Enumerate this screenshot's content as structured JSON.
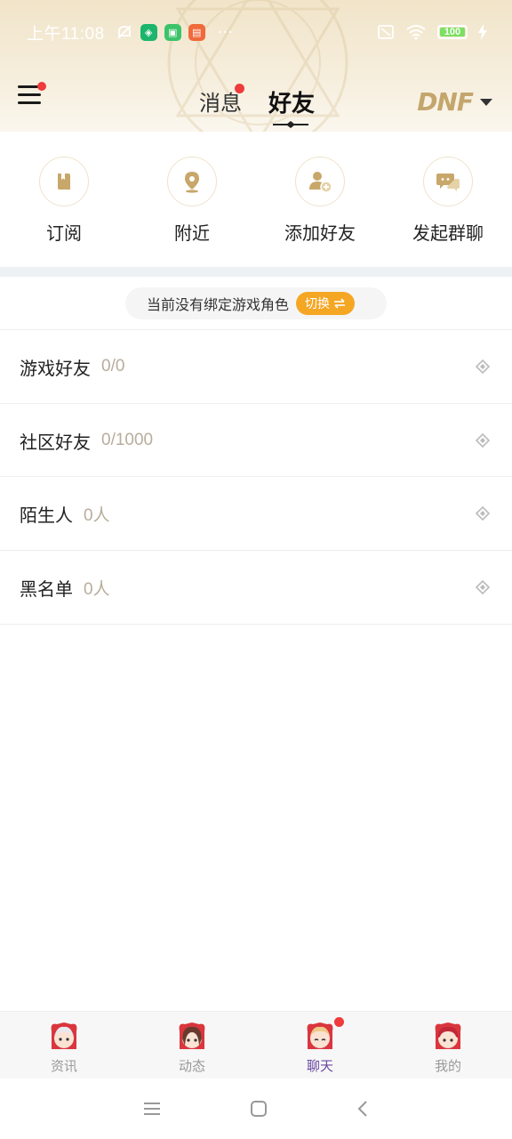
{
  "status_bar": {
    "time": "上午11:08",
    "more": "···",
    "battery_level": "100"
  },
  "header": {
    "tabs": [
      {
        "label": "消息",
        "active": false,
        "has_badge": true
      },
      {
        "label": "好友",
        "active": true,
        "has_badge": false
      }
    ],
    "game_logo": "DNF",
    "menu_has_badge": true
  },
  "quick_actions": [
    {
      "label": "订阅",
      "icon": "bookmark-icon"
    },
    {
      "label": "附近",
      "icon": "location-pin-icon"
    },
    {
      "label": "添加好友",
      "icon": "add-user-icon"
    },
    {
      "label": "发起群聊",
      "icon": "group-chat-icon"
    }
  ],
  "notice": {
    "text": "当前没有绑定游戏角色",
    "switch_label": "切换"
  },
  "friend_groups": [
    {
      "title": "游戏好友",
      "count": "0/0"
    },
    {
      "title": "社区好友",
      "count": "0/1000"
    },
    {
      "title": "陌生人",
      "count": "0人"
    },
    {
      "title": "黑名单",
      "count": "0人"
    }
  ],
  "bottom_tabs": [
    {
      "label": "资讯",
      "active": false
    },
    {
      "label": "动态",
      "active": false
    },
    {
      "label": "聊天",
      "active": true,
      "has_badge": true
    },
    {
      "label": "我的",
      "active": false
    }
  ],
  "colors": {
    "accent_gold": "#c4a66c",
    "badge_red": "#ef3b3b",
    "switch_orange": "#f5a623",
    "active_tab_purple": "#6a4aa0"
  }
}
